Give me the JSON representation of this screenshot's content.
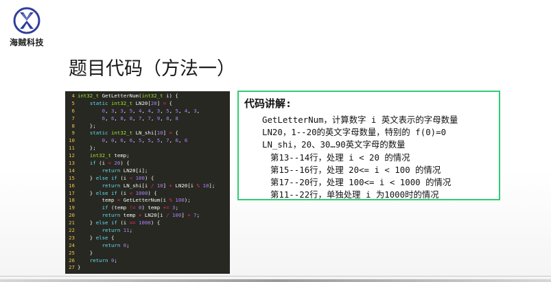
{
  "logo": {
    "text": "海贼科技",
    "icon": "x-logo-icon",
    "color": "#2f3d9c"
  },
  "slide": {
    "title": "题目代码（方法一）"
  },
  "code": {
    "lines": [
      {
        "n": "4",
        "t": "int32_t GetLetterNum(int32_t i) {"
      },
      {
        "n": "5",
        "t": "    static int32_t LN20[20] = {"
      },
      {
        "n": "6",
        "t": "        0, 3, 3, 5, 4, 4, 3, 5, 5, 4, 3,"
      },
      {
        "n": "7",
        "t": "        6, 6, 8, 8, 7, 7, 9, 8, 8"
      },
      {
        "n": "8",
        "t": "    };"
      },
      {
        "n": "9",
        "t": "    static int32_t LN_shi[10] = {"
      },
      {
        "n": "10",
        "t": "        0, 0, 6, 6, 5, 5, 5, 7, 6, 6"
      },
      {
        "n": "11",
        "t": "    };"
      },
      {
        "n": "12",
        "t": "    int32_t temp;"
      },
      {
        "n": "13",
        "t": "    if (i < 20) {"
      },
      {
        "n": "14",
        "t": "        return LN20[i];"
      },
      {
        "n": "15",
        "t": "    } else if (i < 100) {"
      },
      {
        "n": "16",
        "t": "        return LN_shi[i / 10] + LN20[i % 10];"
      },
      {
        "n": "17",
        "t": "    } else if (i < 1000) {"
      },
      {
        "n": "18",
        "t": "        temp = GetLetterNum(i % 100);"
      },
      {
        "n": "19",
        "t": "        if (temp != 0) temp += 3;"
      },
      {
        "n": "20",
        "t": "        return temp + LN20[i / 100] + 7;"
      },
      {
        "n": "21",
        "t": "    } else if (i == 1000) {"
      },
      {
        "n": "22",
        "t": "        return 11;"
      },
      {
        "n": "23",
        "t": "    } else {"
      },
      {
        "n": "24",
        "t": "        return 0;"
      },
      {
        "n": "25",
        "t": "    }"
      },
      {
        "n": "26",
        "t": "    return 0;"
      },
      {
        "n": "27",
        "t": "}"
      }
    ]
  },
  "explain": {
    "title": "代码讲解:",
    "lines": [
      "GetLetterNum，计算数字 i 英文表示的字母数量",
      "LN20，1--20的英文字母数量，特别的 f(0)=0",
      "LN_shi，20、30…90英文字母的数量",
      "第13--14行，处理 i < 20 的情况",
      "第15--16行，处理 20<= i < 100 的情况",
      "第17--20行，处理 100<= i < 1000 的情况",
      "第11--22行，单独处理 i 为1000时的情况"
    ],
    "border_color": "#2ecc71"
  }
}
